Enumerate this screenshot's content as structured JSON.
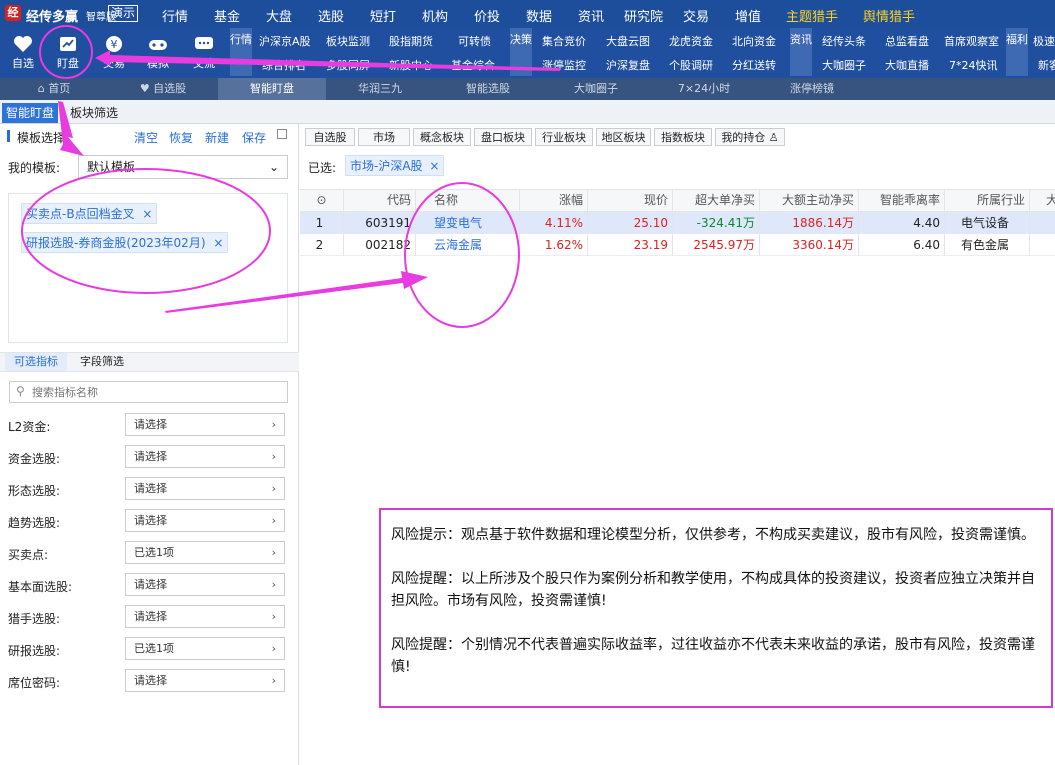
{
  "app": {
    "logo_char": "经",
    "name": "经传多赢",
    "edition": "智尊版",
    "demo": "演示"
  },
  "top_menu": [
    "行情",
    "基金",
    "大盘",
    "选股",
    "短打",
    "机构",
    "价投",
    "数据",
    "资讯",
    "研究院",
    "交易",
    "增值",
    "主题猎手",
    "舆情猎手"
  ],
  "icon_buttons": [
    {
      "label": "自选",
      "icon": "heart-icon"
    },
    {
      "label": "盯盘",
      "icon": "chart-monitor-icon"
    },
    {
      "label": "交易",
      "icon": "yen-icon"
    },
    {
      "label": "模拟",
      "icon": "gamepad-icon"
    },
    {
      "label": "交流",
      "icon": "chat-icon"
    }
  ],
  "section_labels": {
    "hangqing": "行情",
    "juece": "决策",
    "zixun": "资讯",
    "fuli": "福利"
  },
  "quick_links_row1": [
    "沪深京A股",
    "板块监测",
    "股指期货",
    "可转债",
    "集合竞价",
    "大盘云图",
    "龙虎资金",
    "北向资金",
    "经传头条",
    "总监看盘",
    "首席观察室",
    "极速"
  ],
  "quick_links_row2": [
    "综合排名",
    "多股同屏",
    "新股中心",
    "基金综合",
    "涨停监控",
    "沪深复盘",
    "个股调研",
    "分红送转",
    "大咖圈子",
    "大咖直播",
    "7*24快讯",
    "新客"
  ],
  "nav_tabs": [
    "首页",
    "自选股",
    "智能盯盘",
    "华润三九",
    "智能选股",
    "大咖圈子",
    "7×24小时",
    "涨停榜镜"
  ],
  "sub_tabs": [
    "智能盯盘",
    "板块筛选"
  ],
  "left": {
    "title": "模板选择",
    "actions": [
      "清空",
      "恢复",
      "新建",
      "保存"
    ],
    "my_template_label": "我的模板:",
    "my_template_value": "默认模板",
    "chips": [
      "买卖点-B点回档金叉",
      "研报选股-券商金股(2023年02月)"
    ],
    "filter_tabs": [
      "可选指标",
      "字段筛选"
    ],
    "search_placeholder": "搜索指标名称",
    "fields": [
      {
        "label": "L2资金:",
        "value": "请选择"
      },
      {
        "label": "资金选股:",
        "value": "请选择"
      },
      {
        "label": "形态选股:",
        "value": "请选择"
      },
      {
        "label": "趋势选股:",
        "value": "请选择"
      },
      {
        "label": "买卖点:",
        "value": "已选1项"
      },
      {
        "label": "基本面选股:",
        "value": "请选择"
      },
      {
        "label": "猎手选股:",
        "value": "请选择"
      },
      {
        "label": "研报选股:",
        "value": "已选1项"
      },
      {
        "label": "席位密码:",
        "value": "请选择"
      }
    ]
  },
  "board_filters": [
    "自选股",
    "市场",
    "概念板块",
    "盘口板块",
    "行业板块",
    "地区板块",
    "指数板块",
    "我的持仓"
  ],
  "selected": {
    "label": "已选:",
    "chip": "市场-沪深A股"
  },
  "table": {
    "headers": [
      "代码",
      "名称",
      "涨幅",
      "现价",
      "超大单净买",
      "大额主动净买",
      "智能乖离率",
      "所属行业",
      "大"
    ],
    "rows": [
      {
        "no": "1",
        "code": "603191",
        "name": "望变电气",
        "chg": "4.11%",
        "price": "25.10",
        "super": "-324.41万",
        "big": "1886.14万",
        "bias": "4.40",
        "industry": "电气设备"
      },
      {
        "no": "2",
        "code": "002182",
        "name": "云海金属",
        "chg": "1.62%",
        "price": "23.19",
        "super": "2545.97万",
        "big": "3360.14万",
        "bias": "6.40",
        "industry": "有色金属"
      }
    ]
  },
  "notice": [
    "风险提示：观点基于软件数据和理论模型分析，仅供参考，不构成买卖建议，股市有风险，投资需谨慎。",
    "风险提醒：以上所涉及个股只作为案例分析和教学使用，不构成具体的投资建议，投资者应独立决策并自担风险。市场有风险，投资需谨慎!",
    "风险提醒：个别情况不代表普遍实际收益率，过往收益亦不代表未来收益的承诺，股市有风险，投资需谨慎!"
  ],
  "colors": {
    "topbar": "#1d4e9c",
    "accent": "#2a6fd6",
    "annotation": "#e83be0",
    "rise": "#e02020",
    "fall": "#0a8a2a"
  }
}
